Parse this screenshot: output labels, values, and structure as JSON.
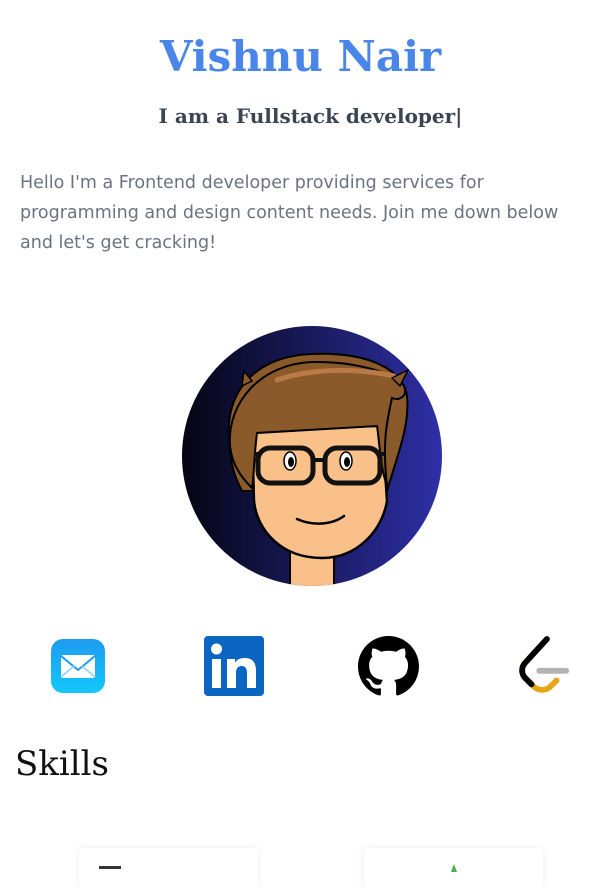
{
  "header": {
    "name": "Vishnu Nair",
    "tagline": "I am a Fullstack developer|"
  },
  "intro": {
    "text": "Hello I'm a Frontend developer providing services for programming and design content needs. Join me down below and let's get cracking!"
  },
  "socials": [
    {
      "icon": "mail-icon"
    },
    {
      "icon": "linkedin-icon",
      "label": "in"
    },
    {
      "icon": "github-icon"
    },
    {
      "icon": "leetcode-icon"
    }
  ],
  "skills": {
    "title": "Skills"
  },
  "colors": {
    "accent": "#4a86e8",
    "tagline": "#3b4552",
    "intro": "#6b7280",
    "linkedin": "#0a66c2",
    "avatar_bg_dark": "#0b0b1f",
    "avatar_bg_light": "#2e2fa6"
  }
}
